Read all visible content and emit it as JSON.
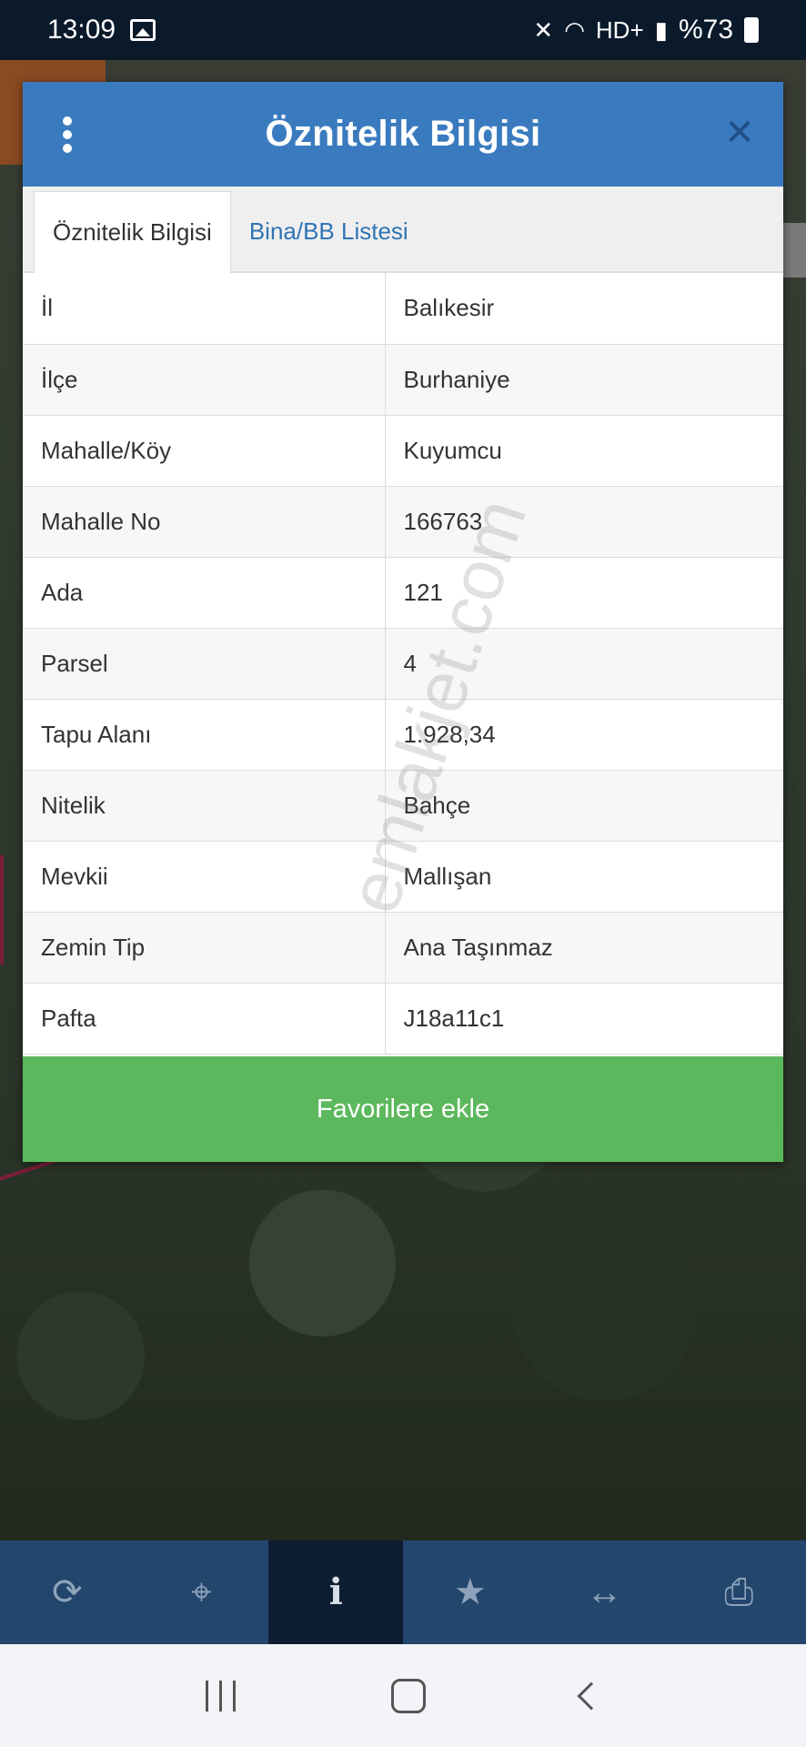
{
  "status_bar": {
    "time": "13:09",
    "battery_percent": "%73",
    "icons": [
      "image-icon",
      "mute-icon",
      "wifi-icon",
      "hd-plus-icon",
      "signal-icon",
      "battery-icon"
    ],
    "hd_label": "HD+"
  },
  "modal": {
    "title": "Öznitelik Bilgisi",
    "tabs": [
      {
        "label": "Öznitelik Bilgisi",
        "active": true
      },
      {
        "label": "Bina/BB Listesi",
        "active": false
      }
    ],
    "rows": [
      {
        "key": "İl",
        "value": "Balıkesir"
      },
      {
        "key": "İlçe",
        "value": "Burhaniye"
      },
      {
        "key": "Mahalle/Köy",
        "value": "Kuyumcu"
      },
      {
        "key": "Mahalle No",
        "value": "166763"
      },
      {
        "key": "Ada",
        "value": "121"
      },
      {
        "key": "Parsel",
        "value": "4"
      },
      {
        "key": "Tapu Alanı",
        "value": "1.928,34"
      },
      {
        "key": "Nitelik",
        "value": "Bahçe"
      },
      {
        "key": "Mevkii",
        "value": "Mallışan"
      },
      {
        "key": "Zemin Tip",
        "value": "Ana Taşınmaz"
      },
      {
        "key": "Pafta",
        "value": "J18a11c1"
      }
    ],
    "favorite_button": "Favorilere ekle"
  },
  "watermark": "emlakjet.com",
  "toolbar": {
    "items": [
      {
        "icon": "refresh-icon",
        "active": false
      },
      {
        "icon": "locate-icon",
        "active": false
      },
      {
        "icon": "info-icon",
        "active": true
      },
      {
        "icon": "star-icon",
        "active": false
      },
      {
        "icon": "measure-icon",
        "active": false
      },
      {
        "icon": "print-icon",
        "active": false
      }
    ]
  },
  "colors": {
    "header": "#3a7bbf",
    "favorite_button": "#5cb85c",
    "toolbar": "#23466d",
    "toolbar_active": "#0d1e33",
    "tab_link": "#2f74b5"
  }
}
